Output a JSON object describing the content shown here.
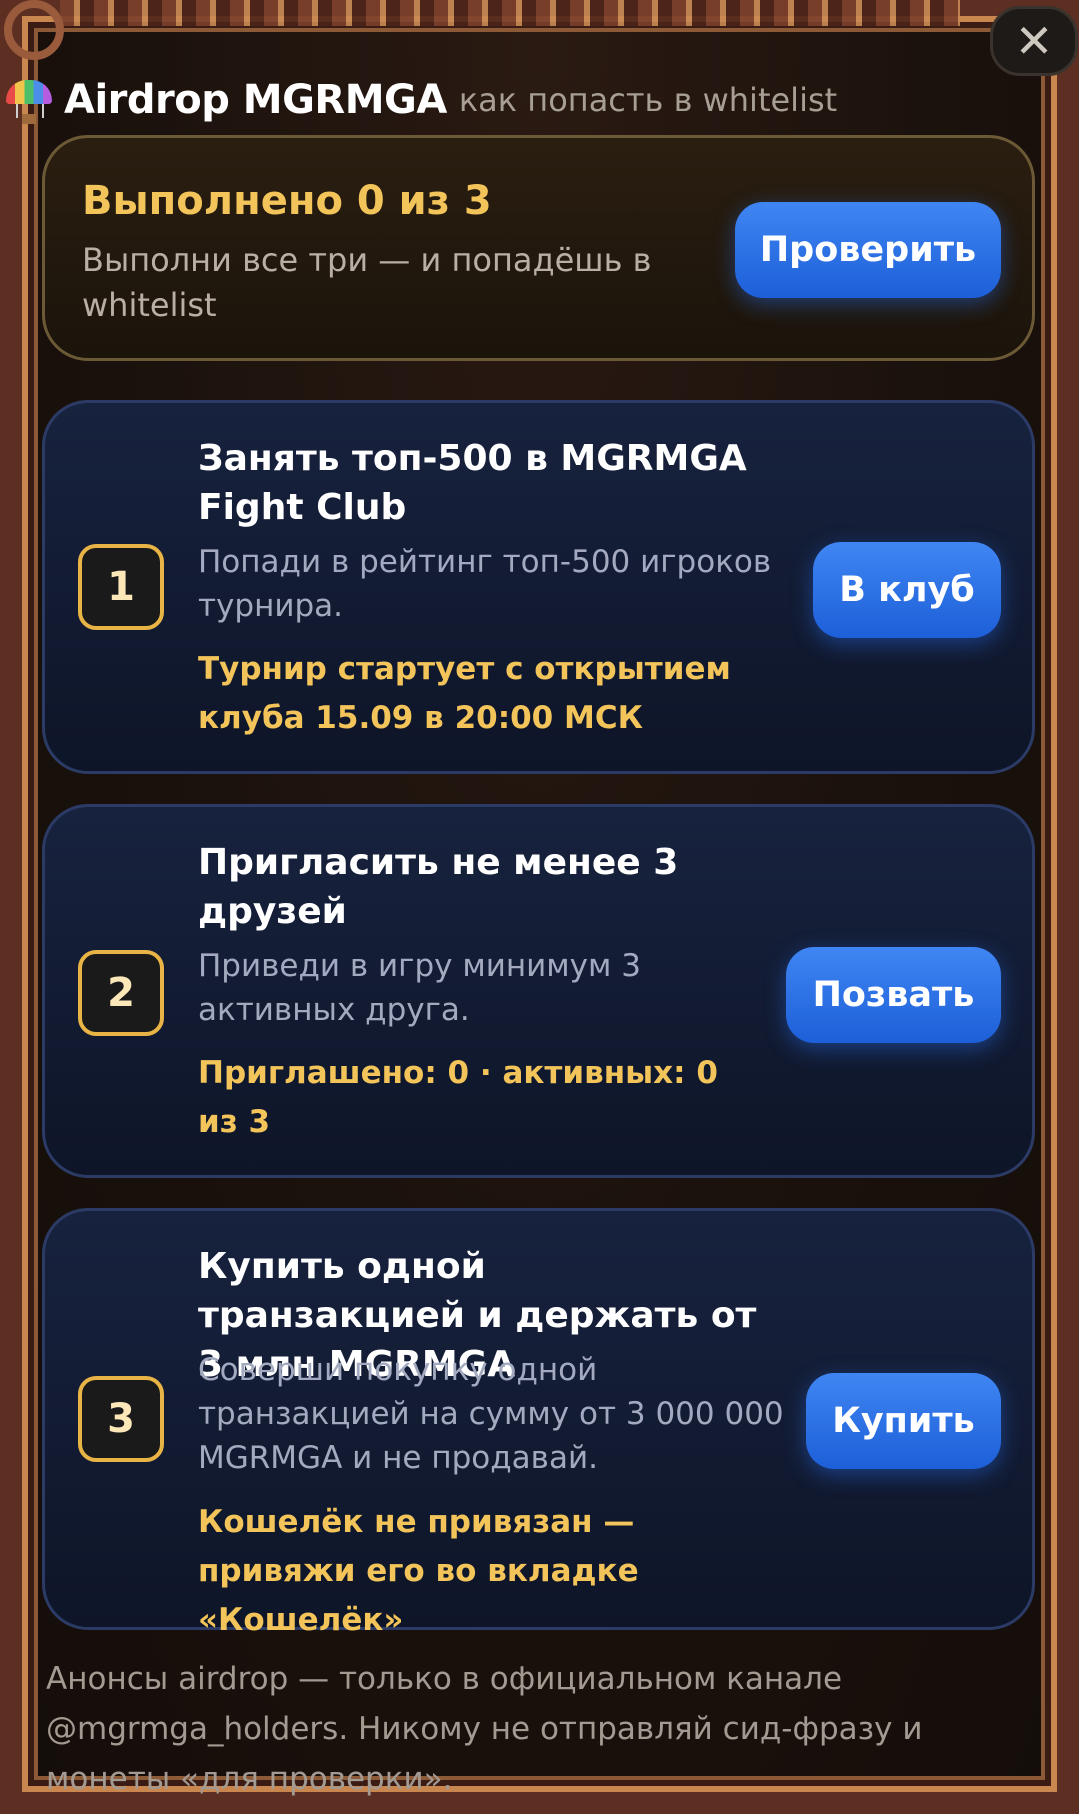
{
  "window": {
    "close_symbol": "✕"
  },
  "header": {
    "icon": "parachute-icon",
    "title": "Airdrop MGRMGA",
    "subtitle": "как попасть в whitelist"
  },
  "progress": {
    "title": "Выполнено 0 из 3",
    "subtitle": "Выполни все три — и попадёшь в whitelist",
    "button_label": "Проверить"
  },
  "tasks": [
    {
      "number": "1",
      "title": "Занять топ-500 в MGRMGA Fight Club",
      "description": "Попади в рейтинг топ-500 игроков турнира.",
      "note": "Турнир стартует с открытием клуба 15.09 в 20:00 МСК",
      "button_label": "В клуб"
    },
    {
      "number": "2",
      "title": "Пригласить не менее 3 друзей",
      "description": "Приведи в игру минимум 3 активных друга.",
      "note": "Приглашено: 0 · активных: 0 из 3",
      "button_label": "Позвать"
    },
    {
      "number": "3",
      "title": "Купить одной транзакцией и держать от 3 млн MGRMGA",
      "description": "Соверши покупку одной транзакцией на сумму от 3 000 000 MGRMGA и не продавай.",
      "note": "Кошелёк не привязан — привяжи его во вкладке «Кошелёк»",
      "button_label": "Купить"
    }
  ],
  "footer": {
    "text": "Анонсы airdrop — только в официальном канале @mgrmga_holders. Никому не отправляй сид-фразу и монеты «для проверки»."
  },
  "colors": {
    "accent_gold": "#f3c45a",
    "button_blue": "#2f74ea",
    "card_navy": "#141d36",
    "frame_brown": "#5c2f22"
  }
}
